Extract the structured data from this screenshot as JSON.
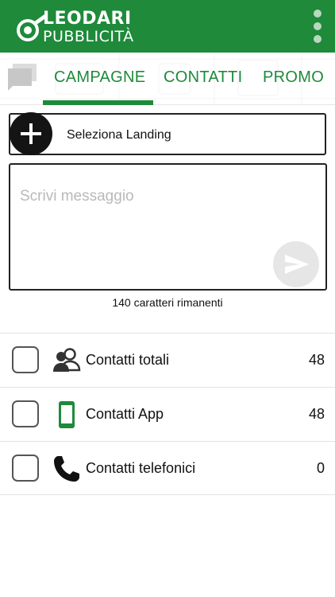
{
  "header": {
    "logo_line1": "LEODARI",
    "logo_line2": "PUBBLICITÀ",
    "brand_color": "#1e8a3a",
    "menu_icon": "more-vert-icon"
  },
  "tabs": [
    {
      "label": "CAMPAGNE",
      "active": true
    },
    {
      "label": "CONTATTI",
      "active": false
    },
    {
      "label": "PROMO",
      "active": false
    }
  ],
  "landing": {
    "add_icon": "plus-icon",
    "label": "Seleziona Landing"
  },
  "message": {
    "placeholder": "Scrivi messaggio",
    "value": "",
    "send_icon": "send-icon",
    "chars_remaining": "140 caratteri rimanenti"
  },
  "contacts": [
    {
      "label": "Contatti totali",
      "count": "48",
      "icon": "group-icon",
      "checked": false
    },
    {
      "label": "Contatti App",
      "count": "48",
      "icon": "smartphone-icon",
      "checked": false
    },
    {
      "label": "Contatti telefonici",
      "count": "0",
      "icon": "phone-icon",
      "checked": false
    }
  ]
}
